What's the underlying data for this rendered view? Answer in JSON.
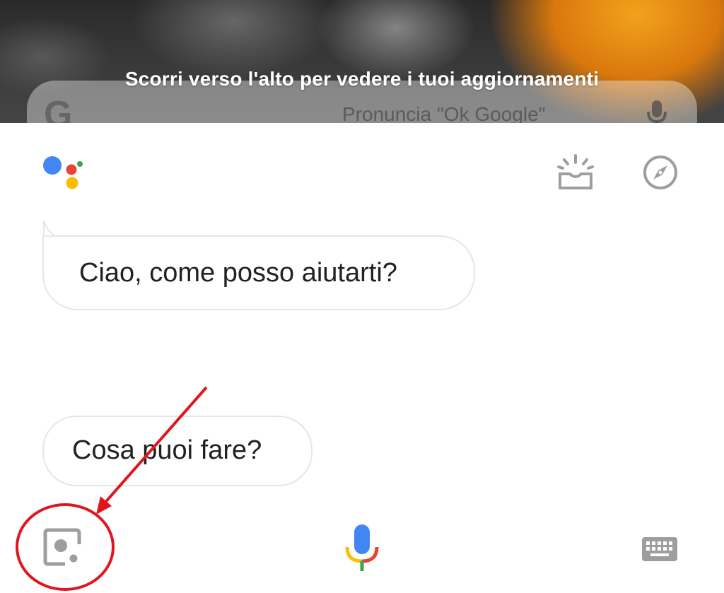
{
  "wallpaper": {
    "swipe_hint": "Scorri verso l'alto per vedere i tuoi aggiornamenti"
  },
  "search_bar": {
    "logo_letter": "G",
    "placeholder": "Pronuncia \"Ok Google\"",
    "icon": "mic-icon"
  },
  "assistant": {
    "logo": "google-assistant-logo",
    "top_icons": [
      "snapshot-icon",
      "explore-compass-icon"
    ],
    "greeting": "Ciao, come posso aiutarti?",
    "suggestion_chip": "Cosa puoi fare?"
  },
  "bottom_bar": {
    "icons": [
      "lens-icon",
      "mic-icon",
      "keyboard-icon"
    ]
  },
  "colors": {
    "blue": "#4285f4",
    "red": "#ea4335",
    "yellow": "#fbbc05",
    "green": "#34a853",
    "icon_gray": "#9e9e9e",
    "annotation_red": "#e0161e"
  }
}
